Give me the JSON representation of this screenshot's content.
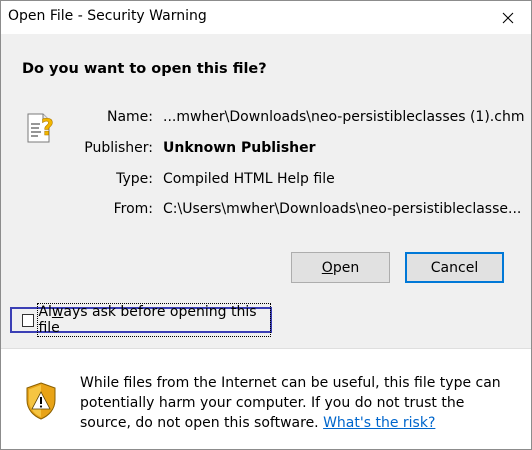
{
  "window": {
    "title": "Open File - Security Warning",
    "close_symbol": "✕"
  },
  "prompt": {
    "question": "Do you want to open this file?"
  },
  "file": {
    "icon": "chm-help-file-icon",
    "name_label": "Name:",
    "name_value": "...mwher\\Downloads\\neo-persistibleclasses (1).chm",
    "publisher_label": "Publisher:",
    "publisher_value": "Unknown Publisher",
    "type_label": "Type:",
    "type_value": "Compiled HTML Help file",
    "from_label": "From:",
    "from_value": "C:\\Users\\mwher\\Downloads\\neo-persistibleclasse..."
  },
  "buttons": {
    "open_access_key": "O",
    "open_rest": "pen",
    "cancel": "Cancel"
  },
  "checkbox": {
    "label_before_key": "Al",
    "access_key": "w",
    "label_after_key": "ays ask before opening this file",
    "checked": false
  },
  "warning": {
    "icon": "security-shield-icon",
    "text": "While files from the Internet can be useful, this file type can potentially harm your computer. If you do not trust the source, do not open this software.",
    "link": "What's the risk?"
  },
  "colors": {
    "accent": "#0078d7",
    "link": "#0066cc",
    "highlight_border": "#3b3fb5"
  }
}
